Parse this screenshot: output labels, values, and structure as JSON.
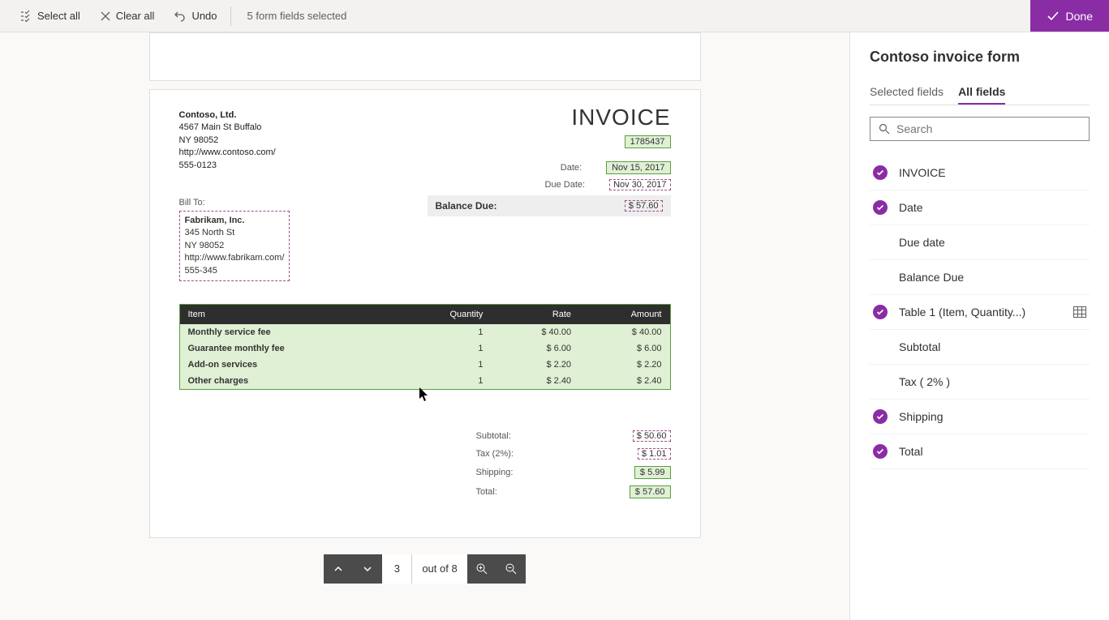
{
  "toolbar": {
    "select_all": "Select all",
    "clear_all": "Clear all",
    "undo": "Undo",
    "status": "5 form fields selected",
    "done": "Done"
  },
  "document": {
    "company": {
      "name": "Contoso, Ltd.",
      "addr1": "4567 Main St Buffalo",
      "addr2": "NY 98052",
      "url": "http://www.contoso.com/",
      "phone": "555-0123"
    },
    "title": "INVOICE",
    "invoice_number": "1785437",
    "meta": {
      "date_label": "Date:",
      "date_value": "Nov 15, 2017",
      "due_label": "Due Date:",
      "due_value": "Nov 30, 2017",
      "balance_label": "Balance Due:",
      "balance_value": "$ 57.60"
    },
    "billto": {
      "label": "Bill To:",
      "name": "Fabrikam, Inc.",
      "addr1": "345 North St",
      "addr2": "NY 98052",
      "url": "http://www.fabrikam.com/",
      "phone": "555-345"
    },
    "table": {
      "headers": [
        "Item",
        "Quantity",
        "Rate",
        "Amount"
      ],
      "rows": [
        {
          "item": "Monthly service fee",
          "qty": "1",
          "rate": "$ 40.00",
          "amount": "$ 40.00"
        },
        {
          "item": "Guarantee monthly fee",
          "qty": "1",
          "rate": "$ 6.00",
          "amount": "$ 6.00"
        },
        {
          "item": "Add-on services",
          "qty": "1",
          "rate": "$ 2.20",
          "amount": "$ 2.20"
        },
        {
          "item": "Other charges",
          "qty": "1",
          "rate": "$ 2.40",
          "amount": "$ 2.40"
        }
      ]
    },
    "totals": {
      "subtotal_label": "Subtotal:",
      "subtotal_value": "$ 50.60",
      "tax_label": "Tax (2%):",
      "tax_value": "$ 1.01",
      "shipping_label": "Shipping:",
      "shipping_value": "$ 5.99",
      "total_label": "Total:",
      "total_value": "$ 57.60"
    }
  },
  "pager": {
    "current": "3",
    "total_text": "out of 8"
  },
  "sidebar": {
    "title": "Contoso invoice form",
    "tabs": {
      "selected": "Selected fields",
      "all": "All fields"
    },
    "search_placeholder": "Search",
    "fields": [
      {
        "label": "INVOICE",
        "selected": true
      },
      {
        "label": "Date",
        "selected": true
      },
      {
        "label": "Due date",
        "selected": false
      },
      {
        "label": "Balance Due",
        "selected": false
      },
      {
        "label": "Table 1 (Item, Quantity...)",
        "selected": true,
        "is_table": true
      },
      {
        "label": "Subtotal",
        "selected": false
      },
      {
        "label": "Tax ( 2% )",
        "selected": false
      },
      {
        "label": "Shipping",
        "selected": true
      },
      {
        "label": "Total",
        "selected": true
      }
    ]
  }
}
